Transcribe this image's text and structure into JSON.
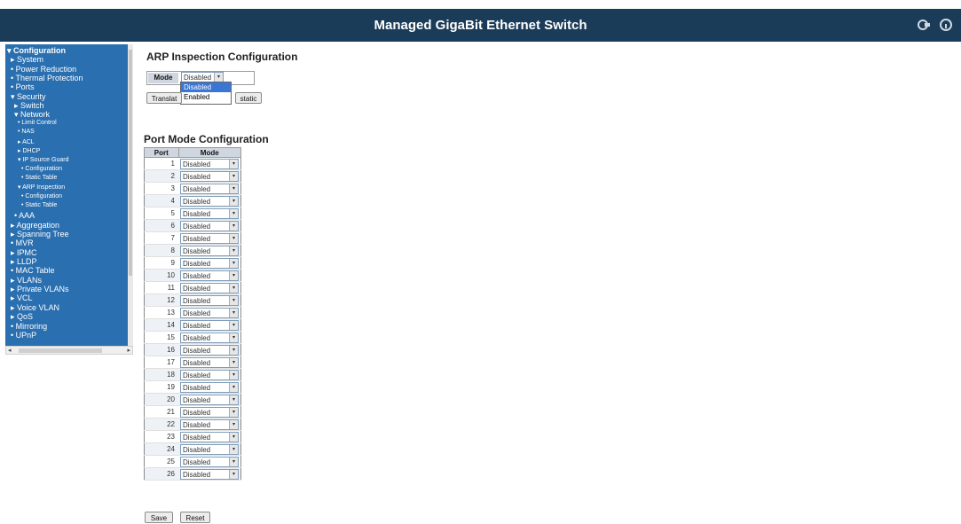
{
  "header": {
    "title": "Managed GigaBit Ethernet Switch",
    "icons": [
      "logout-icon",
      "help-icon"
    ]
  },
  "sidebar": {
    "items": [
      {
        "label": "▾ Configuration",
        "level": 0,
        "bold": true
      },
      {
        "label": "▸ System",
        "level": 1
      },
      {
        "label": "• Power Reduction",
        "level": 1
      },
      {
        "label": "• Thermal Protection",
        "level": 1
      },
      {
        "label": "• Ports",
        "level": 1
      },
      {
        "label": "▾ Security",
        "level": 1
      },
      {
        "label": "▸ Switch",
        "level": 2
      },
      {
        "label": "▾ Network",
        "level": 2
      },
      {
        "label": "• Limit Control",
        "level": 3
      },
      {
        "label": "• NAS",
        "level": 3
      },
      {
        "label": "▸ ACL",
        "level": 3
      },
      {
        "label": "▸ DHCP",
        "level": 3
      },
      {
        "label": "▾ IP Source Guard",
        "level": 3
      },
      {
        "label": "• Configuration",
        "level": 4
      },
      {
        "label": "• Static Table",
        "level": 4
      },
      {
        "label": "▾ ARP Inspection",
        "level": 3
      },
      {
        "label": "• Configuration",
        "level": 4
      },
      {
        "label": "• Static Table",
        "level": 4
      },
      {
        "label": "• AAA",
        "level": 2
      },
      {
        "label": "▸ Aggregation",
        "level": 1
      },
      {
        "label": "▸ Spanning Tree",
        "level": 1
      },
      {
        "label": "• MVR",
        "level": 1
      },
      {
        "label": "▸ IPMC",
        "level": 1
      },
      {
        "label": "▸ LLDP",
        "level": 1
      },
      {
        "label": "• MAC Table",
        "level": 1
      },
      {
        "label": "▸ VLANs",
        "level": 1
      },
      {
        "label": "▸ Private VLANs",
        "level": 1
      },
      {
        "label": "▸ VCL",
        "level": 1
      },
      {
        "label": "▸ Voice VLAN",
        "level": 1
      },
      {
        "label": "▸ QoS",
        "level": 1
      },
      {
        "label": "• Mirroring",
        "level": 1
      },
      {
        "label": "• UPnP",
        "level": 1
      }
    ]
  },
  "arp": {
    "title": "ARP Inspection Configuration",
    "mode_label": "Mode",
    "mode_value": "Disabled",
    "options": [
      "Disabled",
      "Enabled"
    ],
    "translate_label_left": "Translat",
    "translate_label_right": "static"
  },
  "port_mode": {
    "title": "Port Mode Configuration",
    "columns": [
      "Port",
      "Mode"
    ],
    "rows": [
      {
        "port": "1",
        "mode": "Disabled"
      },
      {
        "port": "2",
        "mode": "Disabled"
      },
      {
        "port": "3",
        "mode": "Disabled"
      },
      {
        "port": "4",
        "mode": "Disabled"
      },
      {
        "port": "5",
        "mode": "Disabled"
      },
      {
        "port": "6",
        "mode": "Disabled"
      },
      {
        "port": "7",
        "mode": "Disabled"
      },
      {
        "port": "8",
        "mode": "Disabled"
      },
      {
        "port": "9",
        "mode": "Disabled"
      },
      {
        "port": "10",
        "mode": "Disabled"
      },
      {
        "port": "11",
        "mode": "Disabled"
      },
      {
        "port": "12",
        "mode": "Disabled"
      },
      {
        "port": "13",
        "mode": "Disabled"
      },
      {
        "port": "14",
        "mode": "Disabled"
      },
      {
        "port": "15",
        "mode": "Disabled"
      },
      {
        "port": "16",
        "mode": "Disabled"
      },
      {
        "port": "17",
        "mode": "Disabled"
      },
      {
        "port": "18",
        "mode": "Disabled"
      },
      {
        "port": "19",
        "mode": "Disabled"
      },
      {
        "port": "20",
        "mode": "Disabled"
      },
      {
        "port": "21",
        "mode": "Disabled"
      },
      {
        "port": "22",
        "mode": "Disabled"
      },
      {
        "port": "23",
        "mode": "Disabled"
      },
      {
        "port": "24",
        "mode": "Disabled"
      },
      {
        "port": "25",
        "mode": "Disabled"
      },
      {
        "port": "26",
        "mode": "Disabled"
      }
    ]
  },
  "buttons": {
    "save": "Save",
    "reset": "Reset"
  },
  "colors": {
    "header_bg": "#1b3c58",
    "sidebar_bg": "#2a6fb0",
    "table_header": "#cfd6df",
    "selected_option": "#3a76d3"
  }
}
